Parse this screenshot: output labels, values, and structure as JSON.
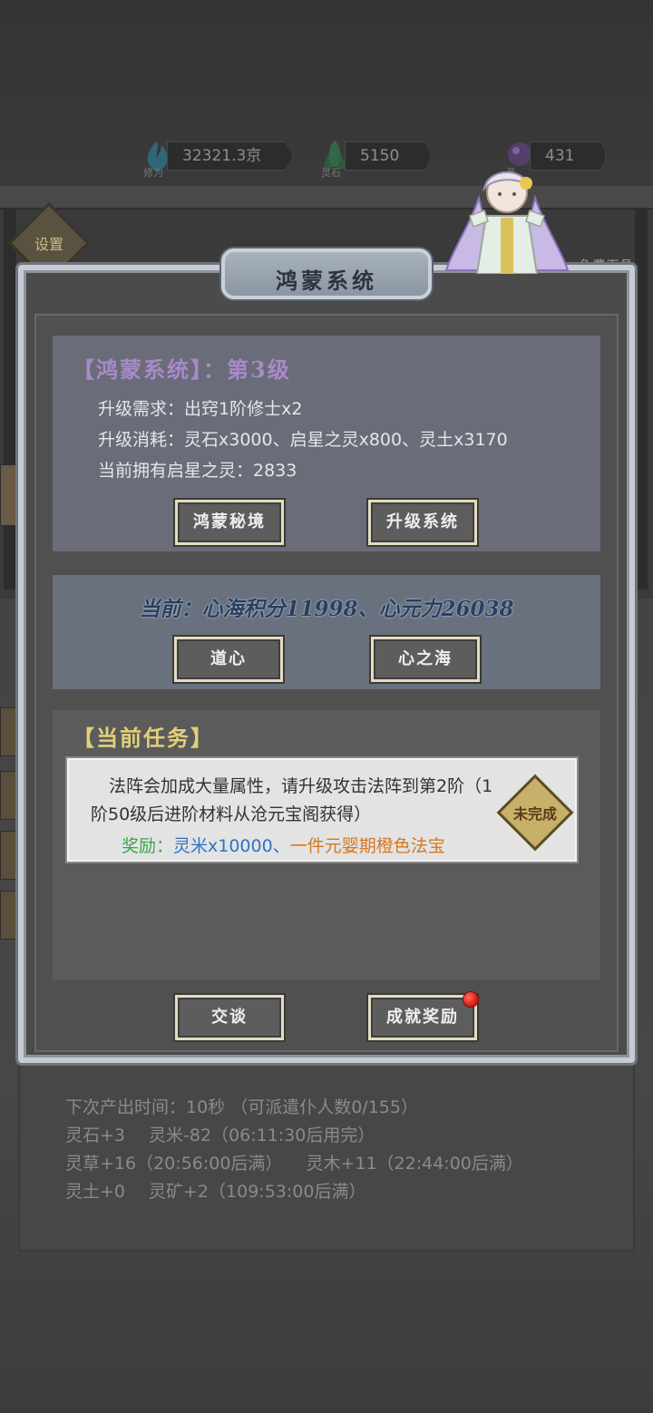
{
  "resources": [
    {
      "label": "修为",
      "value": "32321.3京",
      "icon": "blue-flame-icon",
      "color": "#3fa7c9"
    },
    {
      "label": "灵石",
      "value": "5150",
      "icon": "green-crystal-icon",
      "color": "#3ea05a"
    },
    {
      "label": "晶",
      "value": "431",
      "icon": "purple-crystal-icon",
      "color": "#8a5fb3"
    }
  ],
  "background": {
    "settings_label": "设置",
    "free_crystal_label": "免费天晶",
    "status": {
      "next_output": "下次产出时间：10秒 （可派遣仆人数0/155）",
      "rows": [
        [
          "灵石+3",
          "灵米-82（06:11:30后用完）"
        ],
        [
          "灵草+16（20:56:00后满）",
          "灵木+11（22:44:00后满）"
        ],
        [
          "灵土+0",
          "灵矿+2（109:53:00后满）"
        ]
      ]
    }
  },
  "modal": {
    "title": "鸿蒙系统",
    "system": {
      "heading": "【鸿蒙系统】：第3级",
      "requirement": "升级需求：出窍1阶修士x2",
      "cost": "升级消耗：灵石x3000、启星之灵x800、灵土x3170",
      "owned": "当前拥有启星之灵：2833",
      "btn_secret_realm": "鸿蒙秘境",
      "btn_upgrade": "升级系统"
    },
    "heart": {
      "score_text": "当前：心海积分11998、心元力26038",
      "btn_dao_heart": "道心",
      "btn_heart_sea": "心之海"
    },
    "task": {
      "heading": "【当前任务】",
      "description": "法阵会加成大量属性，请升级攻击法阵到第2阶（1阶50级后进阶材料从沧元宝阁获得）",
      "reward_label": "奖励：",
      "reward_item1": "灵米x10000、",
      "reward_item2": "一件元婴期橙色法宝",
      "status": "未完成"
    },
    "footer": {
      "btn_chat": "交谈",
      "btn_achievement": "成就奖励",
      "has_notification": true
    }
  }
}
